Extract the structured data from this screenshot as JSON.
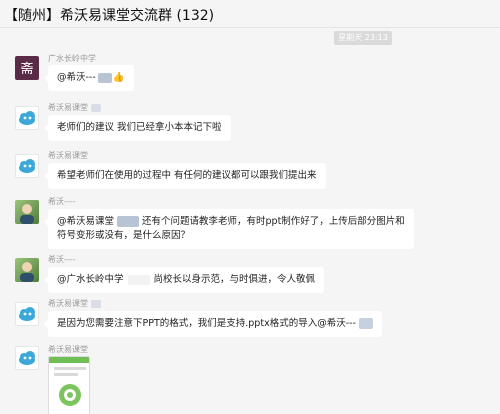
{
  "header": {
    "title": "【随州】希沃易课堂交流群 (132)"
  },
  "timestamp": "星期天 23:13",
  "messages": [
    {
      "sender": "广水长岭中学",
      "text": "@希沃---",
      "emoji": "👍"
    },
    {
      "sender": "希沃易课堂",
      "text": "老师们的建议 我们已经拿小本本记下啦"
    },
    {
      "sender": "希沃易课堂",
      "text": "希望老师们在使用的过程中 有任何的建议都可以跟我们提出来"
    },
    {
      "sender": "希沃----",
      "line1_prefix": "@希沃易课堂",
      "line1_suffix": "还有个问题请教李老师，有时ppt制作好了，上传后部分图片和",
      "line2": "符号变形或没有，是什么原因？"
    },
    {
      "sender": "希沃----",
      "prefix": "@广水长岭中学",
      "text": "尚校长以身示范，与时俱进，令人敬佩"
    },
    {
      "sender": "希沃易课堂",
      "text": "是因为您需要注意下PPT的格式，我们是支持.pptx格式的导入@希沃---"
    },
    {
      "sender": "希沃易课堂"
    }
  ],
  "colors": {
    "background": "#f5f5f5",
    "bubble": "#ffffff",
    "timestamp_bg": "#dadada"
  }
}
